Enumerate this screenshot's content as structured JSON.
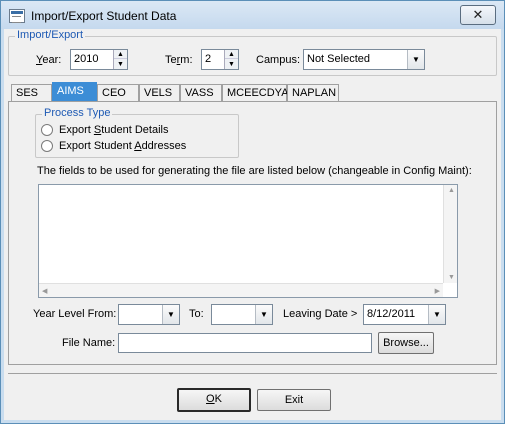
{
  "window": {
    "title": "Import/Export Student Data",
    "close_symbol": "✕"
  },
  "import_export": {
    "group_title": "Import/Export",
    "year": {
      "label_u": "Y",
      "label_rest": "ear:",
      "value": "2010"
    },
    "term": {
      "label_pre": "Te",
      "label_u": "r",
      "label_rest": "m:",
      "value": "2"
    },
    "campus": {
      "label": "Campus:",
      "value": "Not Selected"
    }
  },
  "tabs": [
    {
      "label": "SES",
      "active": false
    },
    {
      "label": "AIMS",
      "active": true
    },
    {
      "label": "CEO",
      "active": false
    },
    {
      "label": "VELS",
      "active": false
    },
    {
      "label": "VASS",
      "active": false
    },
    {
      "label": "MCEECDYA",
      "active": false
    },
    {
      "label": "NAPLAN",
      "active": false
    }
  ],
  "process_type": {
    "group_title": "Process Type",
    "option1": {
      "pre": "Export ",
      "u": "S",
      "rest": "tudent Details",
      "selected": false
    },
    "option2": {
      "pre": "Export Student ",
      "u": "A",
      "rest": "ddresses",
      "selected": false
    }
  },
  "fields_note": "The fields to be used for generating the file are listed below (changeable in Config Maint):",
  "filters": {
    "year_level_from_label": "Year Level From:",
    "year_level_from_value": "",
    "to_label": "To:",
    "to_value": "",
    "leaving_date_label": "Leaving Date >",
    "leaving_date_value": "8/12/2011",
    "file_name_label": "File Name:",
    "file_name_value": "",
    "browse_label": "Browse..."
  },
  "buttons": {
    "ok_u": "O",
    "ok_rest": "K",
    "exit_label": "Exit"
  }
}
